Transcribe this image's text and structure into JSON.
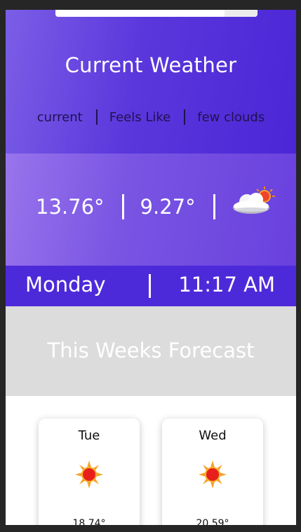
{
  "current": {
    "title": "Current Weather",
    "labels": [
      "current",
      "Feels Like",
      "few clouds"
    ],
    "temp": "13.76°",
    "feels_like": "9.27°",
    "icon": "few-clouds-icon"
  },
  "day": {
    "name": "Monday",
    "time": "11:17 AM"
  },
  "forecast": {
    "title": "This Weeks Forecast",
    "days": [
      {
        "name": "Tue",
        "temp": "18.74°",
        "icon": "sun-icon"
      },
      {
        "name": "Wed",
        "temp": "20.59°",
        "icon": "sun-icon"
      }
    ]
  },
  "colors": {
    "gradient_start": "#7b5ee6",
    "gradient_end": "#4b26d6",
    "day_bar": "#4d2ad9",
    "forecast_header": "#dcdcdc"
  }
}
